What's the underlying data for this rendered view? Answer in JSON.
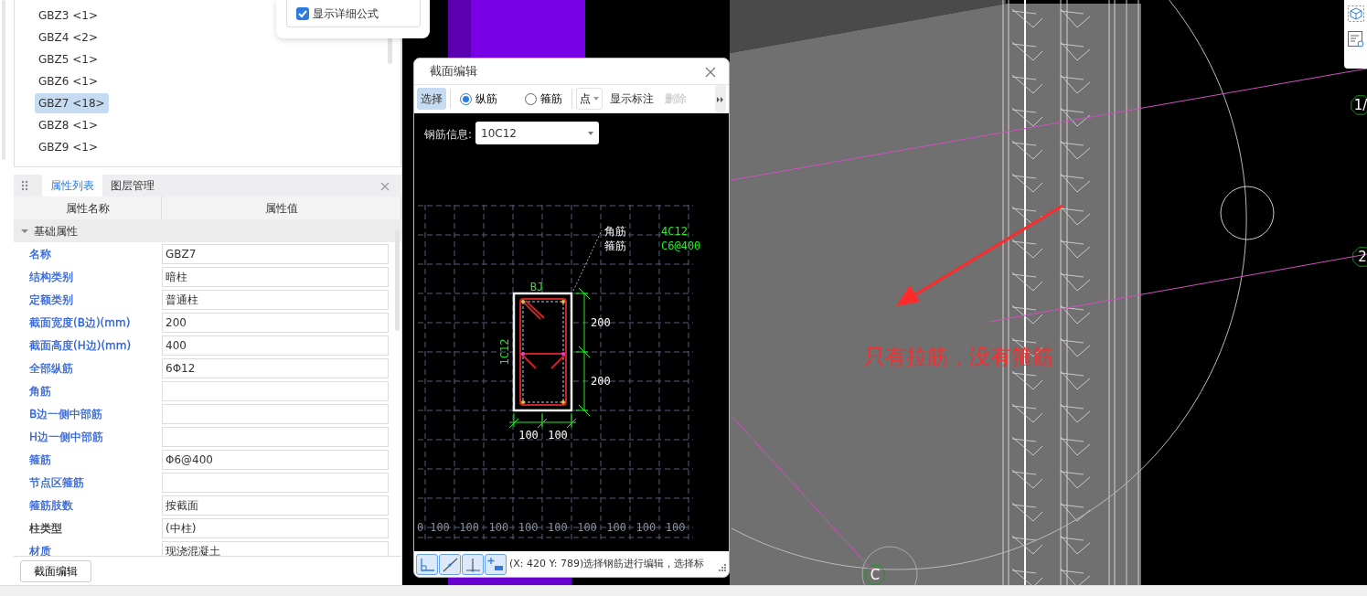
{
  "tree": {
    "items": [
      {
        "label": "GBZ3 <1>",
        "selected": false
      },
      {
        "label": "GBZ4 <2>",
        "selected": false
      },
      {
        "label": "GBZ5 <1>",
        "selected": false
      },
      {
        "label": "GBZ6 <1>",
        "selected": false
      },
      {
        "label": "GBZ7 <18>",
        "selected": true
      },
      {
        "label": "GBZ8 <1>",
        "selected": false
      },
      {
        "label": "GBZ9 <1>",
        "selected": false
      }
    ]
  },
  "popup": {
    "checkbox": {
      "label": "显示详细公式",
      "checked": true
    }
  },
  "panel": {
    "tabs": [
      {
        "label": "属性列表",
        "selected": true
      },
      {
        "label": "图层管理",
        "selected": false
      }
    ],
    "columns": [
      "属性名称",
      "属性值"
    ],
    "group": {
      "label": "基础属性",
      "expanded": true
    },
    "rows": [
      {
        "name": "名称",
        "value": "GBZ7",
        "color": "#2b5fd9"
      },
      {
        "name": "结构类别",
        "value": "暗柱",
        "color": "#2b5fd9"
      },
      {
        "name": "定额类别",
        "value": "普通柱",
        "color": "#2b5fd9"
      },
      {
        "name": "截面宽度(B边)(mm)",
        "value": "200",
        "color": "#2b5fd9"
      },
      {
        "name": "截面高度(H边)(mm)",
        "value": "400",
        "color": "#2b5fd9"
      },
      {
        "name": "全部纵筋",
        "value": "6Φ12",
        "color": "#2b5fd9"
      },
      {
        "name": "角筋",
        "color": "#2b5fd9"
      },
      {
        "name": "B边一侧中部筋",
        "color": "#2b5fd9"
      },
      {
        "name": "H边一侧中部筋",
        "color": "#2b5fd9"
      },
      {
        "name": "箍筋",
        "value": "Φ6@400",
        "color": "#2b5fd9"
      },
      {
        "name": "节点区箍筋",
        "color": "#2b5fd9"
      },
      {
        "name": "箍筋肢数",
        "value": "按截面",
        "color": "#2b5fd9"
      },
      {
        "name": "柱类型",
        "value": "(中柱)",
        "color": "#333333"
      },
      {
        "name": "材质",
        "value": "现浇混凝土",
        "color": "#2b5fd9"
      }
    ],
    "footer_button": "截面编辑"
  },
  "dialog": {
    "title": "截面编辑",
    "toolbar": [
      {
        "kind": "button",
        "label": "选择",
        "selected": true,
        "disabled": false
      },
      {
        "kind": "radio",
        "label": "纵筋",
        "checked": true
      },
      {
        "kind": "radio",
        "label": "箍筋",
        "checked": false
      },
      {
        "kind": "dropdown",
        "label": "点"
      },
      {
        "kind": "button",
        "label": "显示标注",
        "selected": false,
        "disabled": false
      },
      {
        "kind": "button",
        "label": "删除",
        "selected": false,
        "disabled": true
      }
    ],
    "field": {
      "label": "钢筋信息:",
      "value": "10C12"
    },
    "section_drawing": {
      "leader_labels": [
        {
          "text": "角筋",
          "value": "4C12"
        },
        {
          "text": "箍筋",
          "value": "C6@400"
        }
      ],
      "top_label": "BJ",
      "side_label": "1C12",
      "height_dims": [
        "200",
        "200"
      ],
      "width_dims": [
        "100",
        "100"
      ],
      "grid_labels": [
        "0",
        "100",
        "100",
        "100",
        "100",
        "100",
        "100",
        "100",
        "100",
        "100"
      ]
    },
    "status": "(X: 420 Y: 789)选择钢筋进行编辑，选择标"
  },
  "canvas": {
    "annotation": "只有拉筋，没有箍筋",
    "axis_bubbles": [
      {
        "label": "1/"
      },
      {
        "label": "2"
      },
      {
        "label": "C"
      }
    ]
  }
}
